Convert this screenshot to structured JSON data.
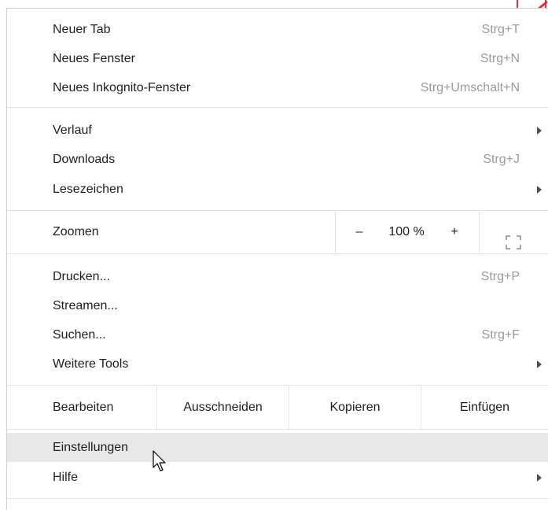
{
  "menu": {
    "items_top": [
      {
        "label": "Neuer Tab",
        "shortcut": "Strg+T"
      },
      {
        "label": "Neues Fenster",
        "shortcut": "Strg+N"
      },
      {
        "label": "Neues Inkognito-Fenster",
        "shortcut": "Strg+Umschalt+N"
      }
    ],
    "items_history": [
      {
        "label": "Verlauf",
        "shortcut": ""
      },
      {
        "label": "Downloads",
        "shortcut": "Strg+J"
      },
      {
        "label": "Lesezeichen",
        "shortcut": ""
      }
    ],
    "zoom": {
      "label": "Zoomen",
      "minus": "–",
      "value": "100 %",
      "plus": "+"
    },
    "items_tools": [
      {
        "label": "Drucken...",
        "shortcut": "Strg+P"
      },
      {
        "label": "Streamen...",
        "shortcut": ""
      },
      {
        "label": "Suchen...",
        "shortcut": "Strg+F"
      },
      {
        "label": "Weitere Tools",
        "shortcut": ""
      }
    ],
    "edit": {
      "label": "Bearbeiten",
      "cut": "Ausschneiden",
      "copy": "Kopieren",
      "paste": "Einfügen"
    },
    "items_bottom": [
      {
        "label": "Einstellungen",
        "shortcut": "",
        "hovered": true
      },
      {
        "label": "Hilfe",
        "shortcut": ""
      }
    ]
  },
  "colors": {
    "accent_fragment": "#e0303a",
    "hover_bg": "#e8e8e8",
    "shortcut_text": "#9a9a9a"
  },
  "icons": [
    "submenu-arrow-icon",
    "fullscreen-icon",
    "mouse-cursor-icon"
  ]
}
